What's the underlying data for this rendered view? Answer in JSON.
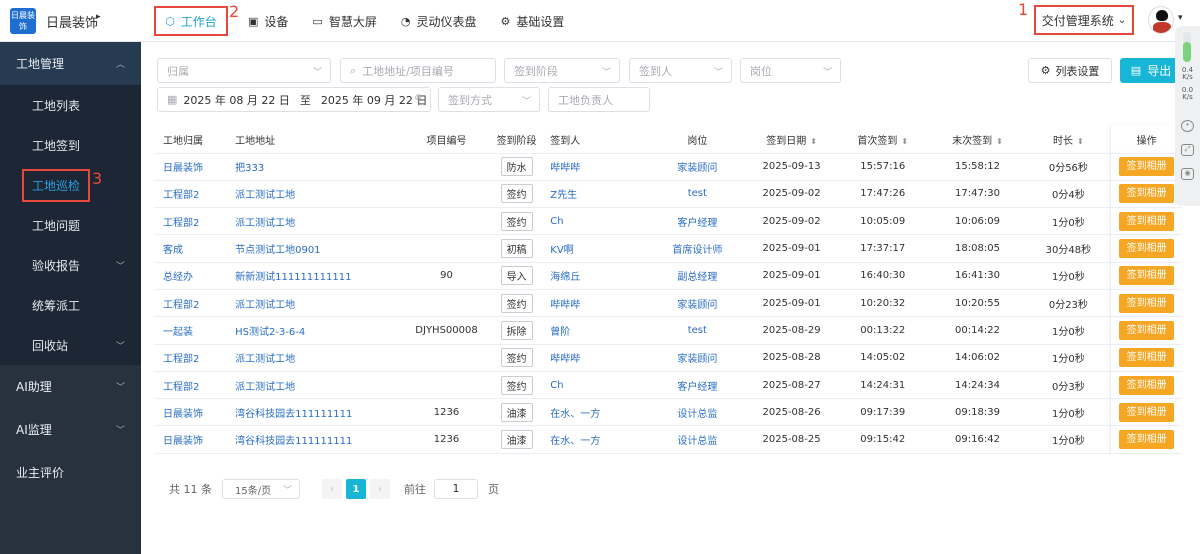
{
  "header": {
    "logo_text": "日晨装饰",
    "brand": "日晨装饰",
    "brand_caret": "▸",
    "nav": [
      {
        "label": "工作台",
        "icon": "cube-icon"
      },
      {
        "label": "设备",
        "icon": "device-icon"
      },
      {
        "label": "智慧大屏",
        "icon": "monitor-icon"
      },
      {
        "label": "灵动仪表盘",
        "icon": "gauge-icon"
      },
      {
        "label": "基础设置",
        "icon": "gear-icon"
      }
    ],
    "system_select": "交付管理系统",
    "annotations": [
      "1",
      "2",
      "3"
    ]
  },
  "sidebar": {
    "groups": [
      {
        "label": "工地管理"
      },
      {
        "label": "AI助理"
      },
      {
        "label": "AI监理"
      },
      {
        "label": "业主评价"
      }
    ],
    "items": [
      {
        "label": "工地列表"
      },
      {
        "label": "工地签到"
      },
      {
        "label": "工地巡检"
      },
      {
        "label": "工地问题"
      },
      {
        "label": "验收报告"
      },
      {
        "label": "统筹派工"
      },
      {
        "label": "回收站"
      }
    ]
  },
  "filters": {
    "belong": "归属",
    "search_placeholder": "工地地址/项目编号",
    "stage": "签到阶段",
    "person": "签到人",
    "post": "岗位",
    "date_start": "2025 年 08 月 22 日",
    "date_to": "至",
    "date_end": "2025 年 09 月 22 日",
    "method": "签到方式",
    "manager": "工地负责人"
  },
  "actions": {
    "list_settings": "列表设置",
    "export": "导出"
  },
  "table": {
    "headers": [
      "工地归属",
      "工地地址",
      "项目编号",
      "签到阶段",
      "签到人",
      "岗位",
      "签到日期",
      "首次签到",
      "末次签到",
      "时长",
      "操作"
    ],
    "rows": [
      {
        "belong": "日晨装饰",
        "addr": "把333",
        "code": "",
        "stage": "防水",
        "person": "哔哔哔",
        "post": "家装顾问",
        "date": "2025-09-13",
        "first": "15:57:16",
        "last": "15:58:12",
        "dur": "0分56秒",
        "op": "签到相册"
      },
      {
        "belong": "工程部2",
        "addr": "派工测试工地",
        "code": "",
        "stage": "签约",
        "person": "Z先生",
        "post": "test",
        "date": "2025-09-02",
        "first": "17:47:26",
        "last": "17:47:30",
        "dur": "0分4秒",
        "op": "签到相册"
      },
      {
        "belong": "工程部2",
        "addr": "派工测试工地",
        "code": "",
        "stage": "签约",
        "person": "Ch",
        "post": "客户经理",
        "date": "2025-09-02",
        "first": "10:05:09",
        "last": "10:06:09",
        "dur": "1分0秒",
        "op": "签到相册"
      },
      {
        "belong": "客成",
        "addr": "节点测试工地0901",
        "code": "",
        "stage": "初稿",
        "person": "KV啊",
        "post": "首席设计师",
        "date": "2025-09-01",
        "first": "17:37:17",
        "last": "18:08:05",
        "dur": "30分48秒",
        "op": "签到相册"
      },
      {
        "belong": "总经办",
        "addr": "新新测试111111111111",
        "code": "90",
        "stage": "导入",
        "person": "海绵丘",
        "post": "副总经理",
        "date": "2025-09-01",
        "first": "16:40:30",
        "last": "16:41:30",
        "dur": "1分0秒",
        "op": "签到相册"
      },
      {
        "belong": "工程部2",
        "addr": "派工测试工地",
        "code": "",
        "stage": "签约",
        "person": "哔哔哔",
        "post": "家装顾问",
        "date": "2025-09-01",
        "first": "10:20:32",
        "last": "10:20:55",
        "dur": "0分23秒",
        "op": "签到相册"
      },
      {
        "belong": "一起装",
        "addr": "HS测试2-3-6-4",
        "code": "DJYHS00008",
        "stage": "拆除",
        "person": "曾阶",
        "post": "test",
        "date": "2025-08-29",
        "first": "00:13:22",
        "last": "00:14:22",
        "dur": "1分0秒",
        "op": "签到相册"
      },
      {
        "belong": "工程部2",
        "addr": "派工测试工地",
        "code": "",
        "stage": "签约",
        "person": "哔哔哔",
        "post": "家装顾问",
        "date": "2025-08-28",
        "first": "14:05:02",
        "last": "14:06:02",
        "dur": "1分0秒",
        "op": "签到相册"
      },
      {
        "belong": "工程部2",
        "addr": "派工测试工地",
        "code": "",
        "stage": "签约",
        "person": "Ch",
        "post": "客户经理",
        "date": "2025-08-27",
        "first": "14:24:31",
        "last": "14:24:34",
        "dur": "0分3秒",
        "op": "签到相册"
      },
      {
        "belong": "日晨装饰",
        "addr": "湾谷科技园去111111111",
        "code": "1236",
        "stage": "油漆",
        "person": "在水、一方",
        "post": "设计总监",
        "date": "2025-08-26",
        "first": "09:17:39",
        "last": "09:18:39",
        "dur": "1分0秒",
        "op": "签到相册"
      },
      {
        "belong": "日晨装饰",
        "addr": "湾谷科技园去111111111",
        "code": "1236",
        "stage": "油漆",
        "person": "在水、一方",
        "post": "设计总监",
        "date": "2025-08-25",
        "first": "09:15:42",
        "last": "09:16:42",
        "dur": "1分0秒",
        "op": "签到相册"
      }
    ]
  },
  "pager": {
    "total": "共 11 条",
    "size": "15条/页",
    "prev": "‹",
    "current": "1",
    "next": "›",
    "goto_label": "前往",
    "goto_value": "1",
    "page_unit": "页"
  },
  "rail": {
    "speed_up": "0.4",
    "speed_up_unit": "K/s",
    "speed_down": "0.0",
    "speed_down_unit": "K/s"
  }
}
